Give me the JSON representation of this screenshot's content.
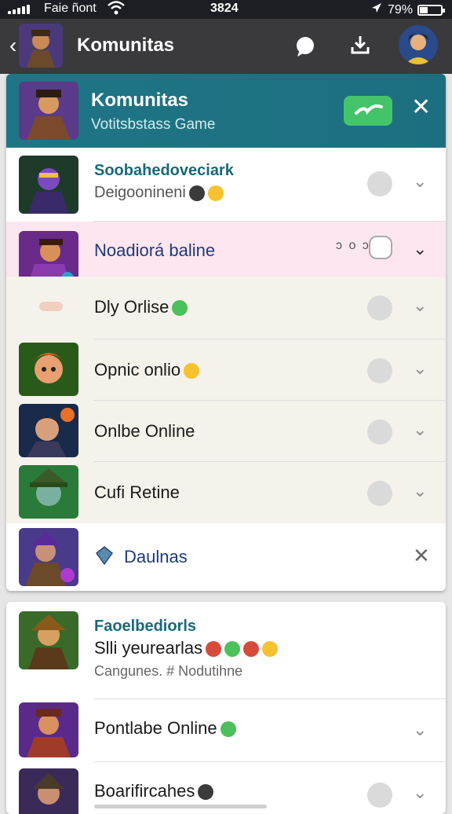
{
  "status_bar": {
    "carrier": "Faie ñont",
    "time": "3824",
    "battery": "79%"
  },
  "header": {
    "title": "Komunitas",
    "icons": [
      "back-icon",
      "chat-icon",
      "download-icon",
      "avatar"
    ]
  },
  "banner": {
    "title": "Komunitas",
    "subtitle": "Votitsbstass Game"
  },
  "rows": [
    {
      "name": "Soobahedoveciark",
      "sub": "Deigoonineni"
    },
    {
      "label": "Noadiorá baline",
      "typing": "ɔ o ɔ"
    },
    {
      "label": "Dly Orlise"
    },
    {
      "label": "Opnic onlio"
    },
    {
      "label": "Onlbe Online"
    },
    {
      "label": "Cufi Retine"
    },
    {
      "label": "Daulnas"
    }
  ],
  "card2": {
    "name": "Faoelbediorls",
    "message": "Slli yeurearlas",
    "meta": "Cangunes. #  Nodutihne",
    "rows": [
      {
        "label": "Pontlabe Online"
      },
      {
        "label": "Boarifircahes"
      }
    ]
  },
  "colors": {
    "banner": "#1f7585",
    "accent_green": "#44c46a",
    "highlight_row": "#fde6ef",
    "header": "#3a3a3c"
  }
}
